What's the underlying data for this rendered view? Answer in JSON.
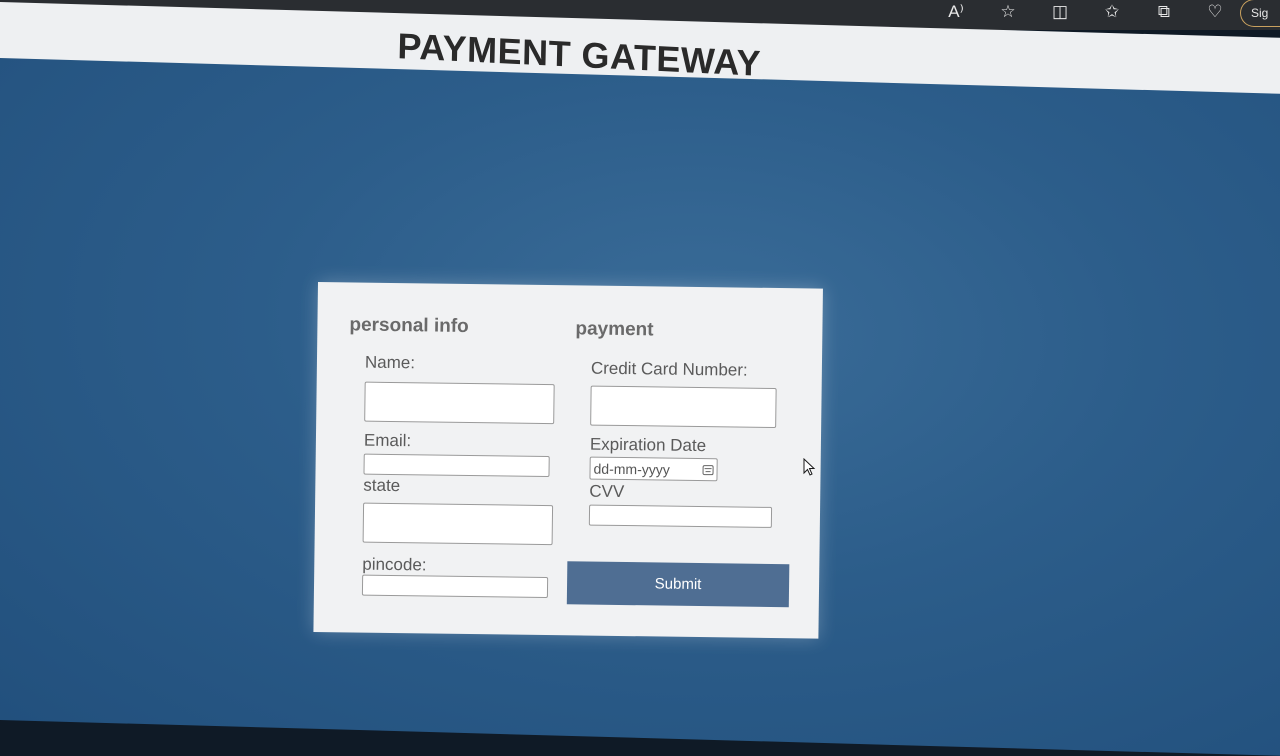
{
  "browser": {
    "toolbar_icons": [
      "read-aloud-icon",
      "star-icon",
      "split-screen-icon",
      "favorites-icon",
      "collections-icon",
      "health-icon"
    ],
    "read_aloud_glyph": "A⁾",
    "sign_in_label": "Sig"
  },
  "header": {
    "title": "PAYMENT GATEWAY"
  },
  "form": {
    "personal": {
      "heading": "personal info",
      "name_label": "Name:",
      "name_value": "",
      "email_label": "Email:",
      "email_value": "",
      "state_label": "state",
      "state_value": "",
      "pincode_label": "pincode:",
      "pincode_value": ""
    },
    "payment": {
      "heading": "payment",
      "card_label": "Credit Card Number:",
      "card_value": "",
      "expiry_label": "Expiration Date",
      "expiry_placeholder": "dd-mm-yyyy",
      "cvv_label": "CVV",
      "cvv_value": ""
    },
    "submit_label": "Submit"
  },
  "colors": {
    "page_background": "#2c5d8a",
    "card_background": "#f1f2f3",
    "submit_button": "#4f6e93",
    "header_background": "#eef0f2"
  }
}
